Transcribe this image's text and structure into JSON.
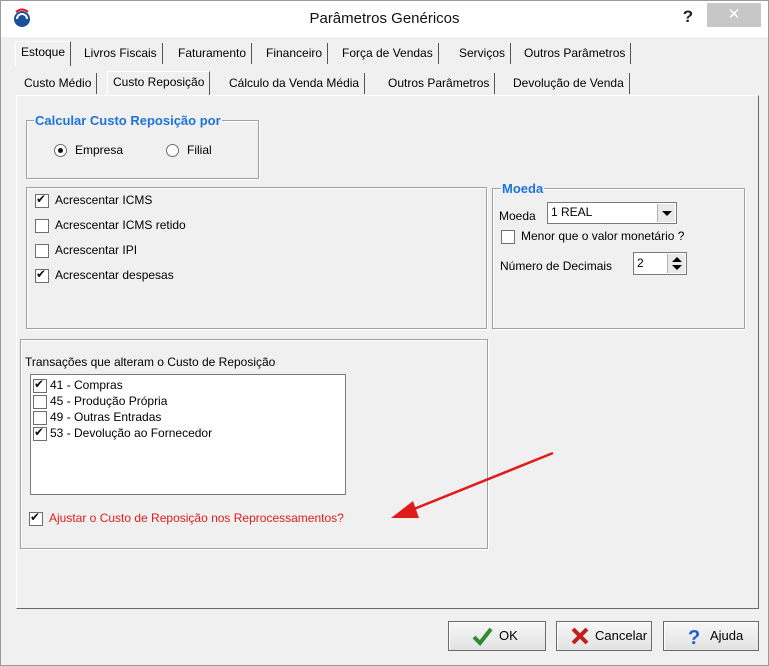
{
  "window": {
    "title": "Parâmetros Genéricos",
    "help": "?",
    "close": "✕"
  },
  "main_tabs": [
    "Estoque",
    "Livros Fiscais",
    "Faturamento",
    "Financeiro",
    "Força de Vendas",
    "Serviços",
    "Outros Parâmetros"
  ],
  "sub_tabs": [
    "Custo Médio",
    "Custo Reposição",
    "Cálculo da Venda Média",
    "Outros Parâmetros",
    "Devolução de Venda"
  ],
  "calc_group": {
    "legend": "Calcular Custo Reposição por",
    "empresa": "Empresa",
    "filial": "Filial",
    "selected": "Empresa"
  },
  "checks": [
    {
      "label": "Acrescentar ICMS",
      "checked": true
    },
    {
      "label": "Acrescentar ICMS retido",
      "checked": false
    },
    {
      "label": "Acrescentar IPI",
      "checked": false
    },
    {
      "label": "Acrescentar despesas",
      "checked": true
    }
  ],
  "moeda": {
    "legend": "Moeda",
    "label": "Moeda",
    "value": "1 REAL",
    "menor_label": "Menor que o valor monetário ?",
    "menor_checked": false,
    "decimais_label": "Número de Decimais",
    "decimais_value": "2"
  },
  "transacoes": {
    "label": "Transações que alteram o Custo de Reposição",
    "items": [
      {
        "label": "41 - Compras",
        "checked": true
      },
      {
        "label": "45 - Produção Própria",
        "checked": false
      },
      {
        "label": "49 - Outras Entradas",
        "checked": false
      },
      {
        "label": "53 - Devolução ao Fornecedor",
        "checked": true
      }
    ],
    "ajustar_label": "Ajustar o Custo de Reposição nos Reprocessamentos?",
    "ajustar_checked": true
  },
  "buttons": {
    "ok": "OK",
    "cancelar": "Cancelar",
    "ajuda": "Ajuda"
  },
  "colors": {
    "legend": "#1e73d8",
    "annotation": "#e01b1b",
    "ok_icon": "#2e8b2e",
    "cancel_icon": "#c0201a",
    "help_icon": "#1e5fd0"
  }
}
